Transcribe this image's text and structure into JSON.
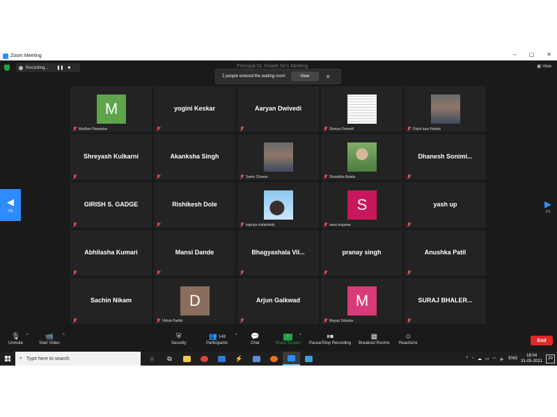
{
  "window": {
    "title": "Zoom Meeting",
    "controls": [
      "–",
      "▢",
      "✕"
    ]
  },
  "topbar": {
    "recording_label": "Recording...",
    "meeting_title_hidden": "Principal Dr. Khade Sir's Meeting",
    "toast_text": "2 people entered the waiting room",
    "toast_button": "View",
    "view_label": "View"
  },
  "participants": [
    {
      "name": "Madhuri Pawaskar",
      "type": "avatar",
      "initial": "M",
      "color": "#5da44a"
    },
    {
      "name": "yogini Keskar",
      "type": "name"
    },
    {
      "name": "Aaryan Dwivedi",
      "type": "name"
    },
    {
      "name": "Shreya Dwivedi",
      "type": "photo",
      "photo": "document"
    },
    {
      "name": "Divjot kaur Nanda",
      "type": "photo",
      "photo": "person"
    },
    {
      "name": "Shreyash Kulkarni",
      "type": "name"
    },
    {
      "name": "Akanksha Singh",
      "type": "name"
    },
    {
      "name": "Samir Chavan",
      "type": "photo",
      "photo": "person"
    },
    {
      "name": "Shraddha Butala",
      "type": "photo",
      "photo": "person-green"
    },
    {
      "name": "Dhanesh  Sonimi...",
      "type": "name"
    },
    {
      "name": "GIRISH S. GADGE",
      "type": "name"
    },
    {
      "name": "Rishikesh Dole",
      "type": "name"
    },
    {
      "name": "supriya malashetty",
      "type": "photo",
      "photo": "person-sky"
    },
    {
      "name": "sana mujawar",
      "type": "avatar",
      "initial": "S",
      "color": "#c8175a"
    },
    {
      "name": "yash up",
      "type": "name"
    },
    {
      "name": "Abhilasha Kumari",
      "type": "name"
    },
    {
      "name": "Mansi Dande",
      "type": "name"
    },
    {
      "name": "Bhagyashala  Vil...",
      "type": "name"
    },
    {
      "name": "pranay singh",
      "type": "name"
    },
    {
      "name": "Anushka Patil",
      "type": "name"
    },
    {
      "name": "Sachin Nikam",
      "type": "name"
    },
    {
      "name": "Vidula Parkhi",
      "type": "avatar",
      "initial": "D",
      "color": "#8a6d5c"
    },
    {
      "name": "Arjun Gaikwad",
      "type": "name"
    },
    {
      "name": "Mayuri Solunke",
      "type": "avatar",
      "initial": "M",
      "color": "#d93a78"
    },
    {
      "name": "SURAJ  BHALER...",
      "type": "name"
    }
  ],
  "pagination": {
    "left": "2/6",
    "right": "2/6"
  },
  "toolbar": {
    "unmute": "Unmute",
    "start_video": "Start Video",
    "security": "Security",
    "participants": "Participants",
    "participants_count": "148",
    "chat": "Chat",
    "share_screen": "Share Screen",
    "pause_recording": "Pause/Stop Recording",
    "breakout_rooms": "Breakout Rooms",
    "reactions": "Reactions",
    "end": "End"
  },
  "taskbar": {
    "search_placeholder": "Type here to search",
    "language": "ENG",
    "time": "18:04",
    "date": "31-05-2021",
    "notifications": "20"
  },
  "colors": {
    "zoom_blue": "#2d8cff",
    "share_green": "#23a047",
    "end_red": "#e02828"
  }
}
